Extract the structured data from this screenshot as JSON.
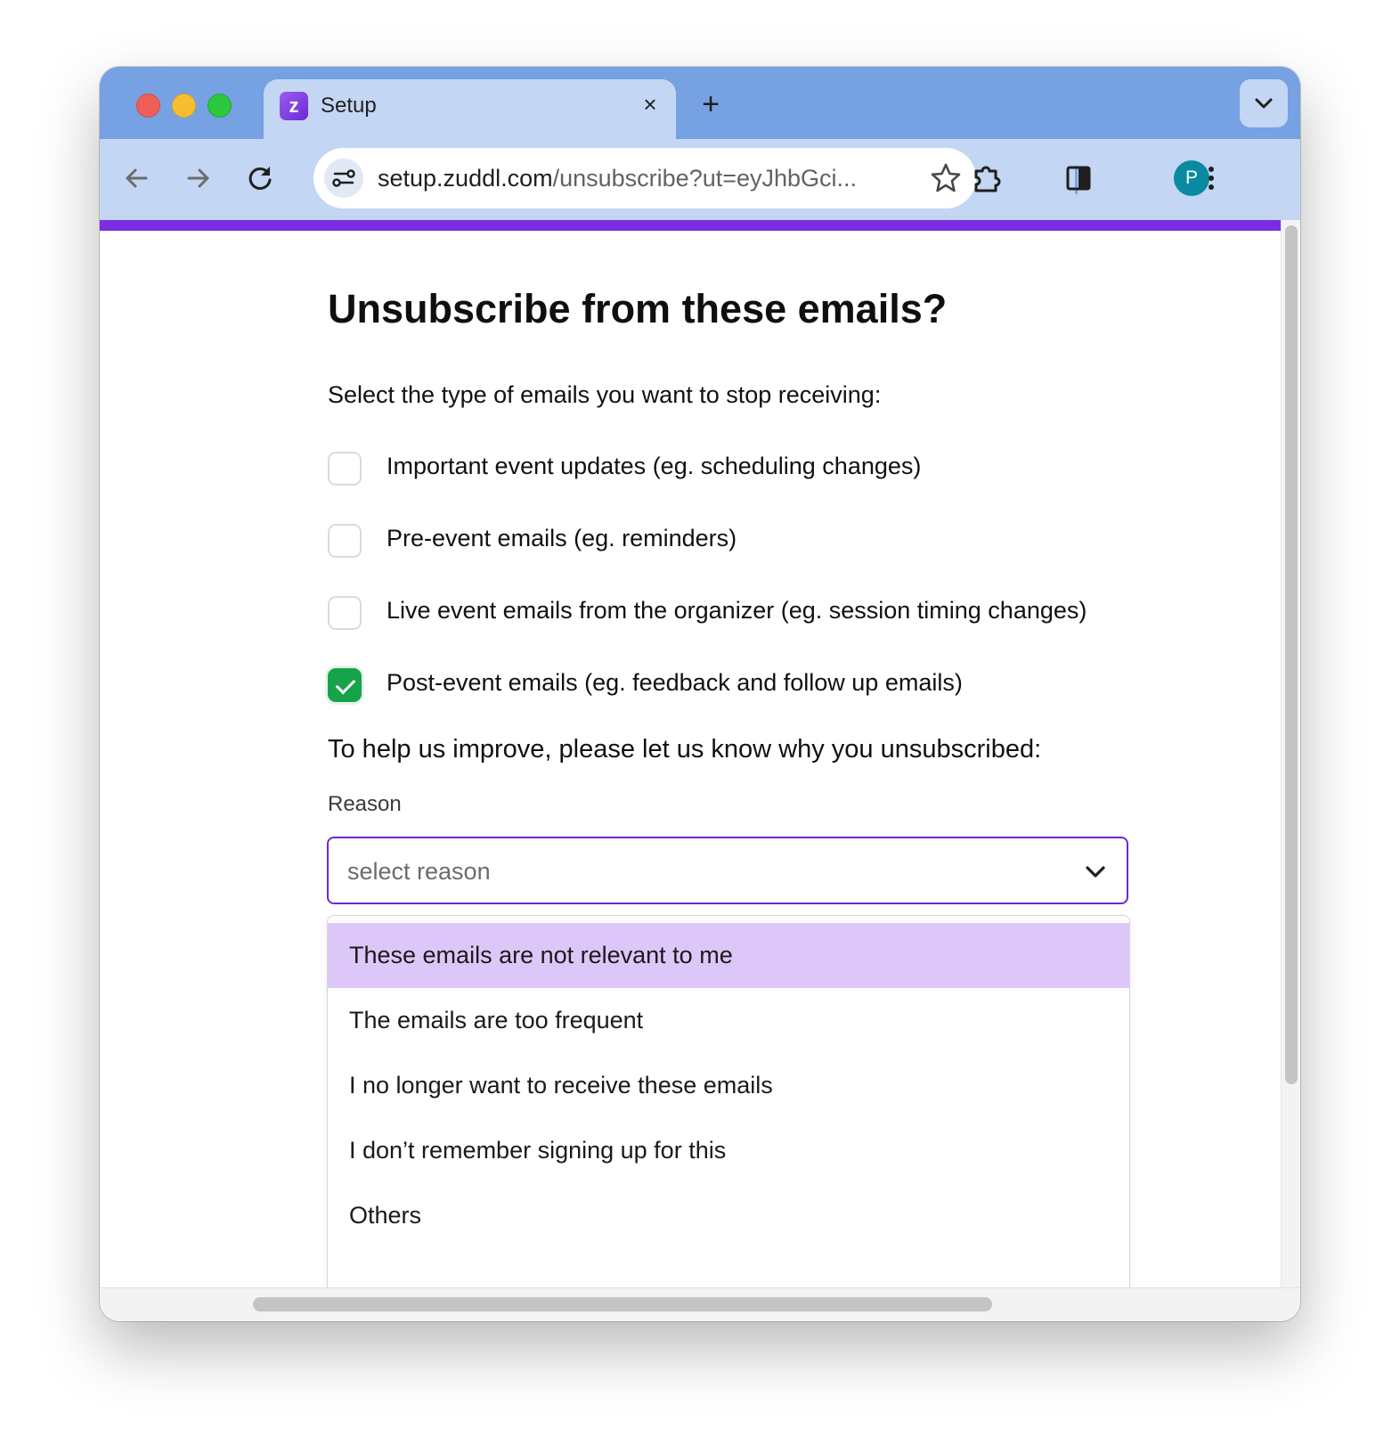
{
  "browser": {
    "tab_title": "Setup",
    "tab_favicon_letter": "z",
    "tab_close": "×",
    "new_tab": "+",
    "url_host": "setup.zuddl.com",
    "url_path": "/unsubscribe?ut=eyJhbGci...",
    "profile_initial": "P",
    "icons": [
      "back-icon",
      "forward-icon",
      "reload-icon",
      "site-info-icon",
      "bookmark-star-icon",
      "extensions-icon",
      "side-panel-icon",
      "menu-dots-icon",
      "tab-search-chevron-icon"
    ]
  },
  "page": {
    "accent_color": "#7b2de0",
    "title": "Unsubscribe from these emails?",
    "subtitle": "Select the type of emails you want to stop receiving:",
    "options": [
      {
        "label": "Important event updates (eg. scheduling changes)",
        "checked": false
      },
      {
        "label": "Pre-event emails (eg. reminders)",
        "checked": false
      },
      {
        "label": "Live event emails from the organizer (eg. session timing changes)",
        "checked": false
      },
      {
        "label": "Post-event emails (eg. feedback and follow up emails)",
        "checked": true
      }
    ],
    "help_text": "To help us improve, please let us know why you unsubscribed:",
    "reason_label": "Reason",
    "reason_placeholder": "select reason",
    "reasons": [
      "These emails are not relevant to me",
      "The emails are too frequent",
      "I no longer want to receive these emails",
      "I don’t remember signing up for this",
      "Others"
    ],
    "highlighted_reason_index": 0
  }
}
